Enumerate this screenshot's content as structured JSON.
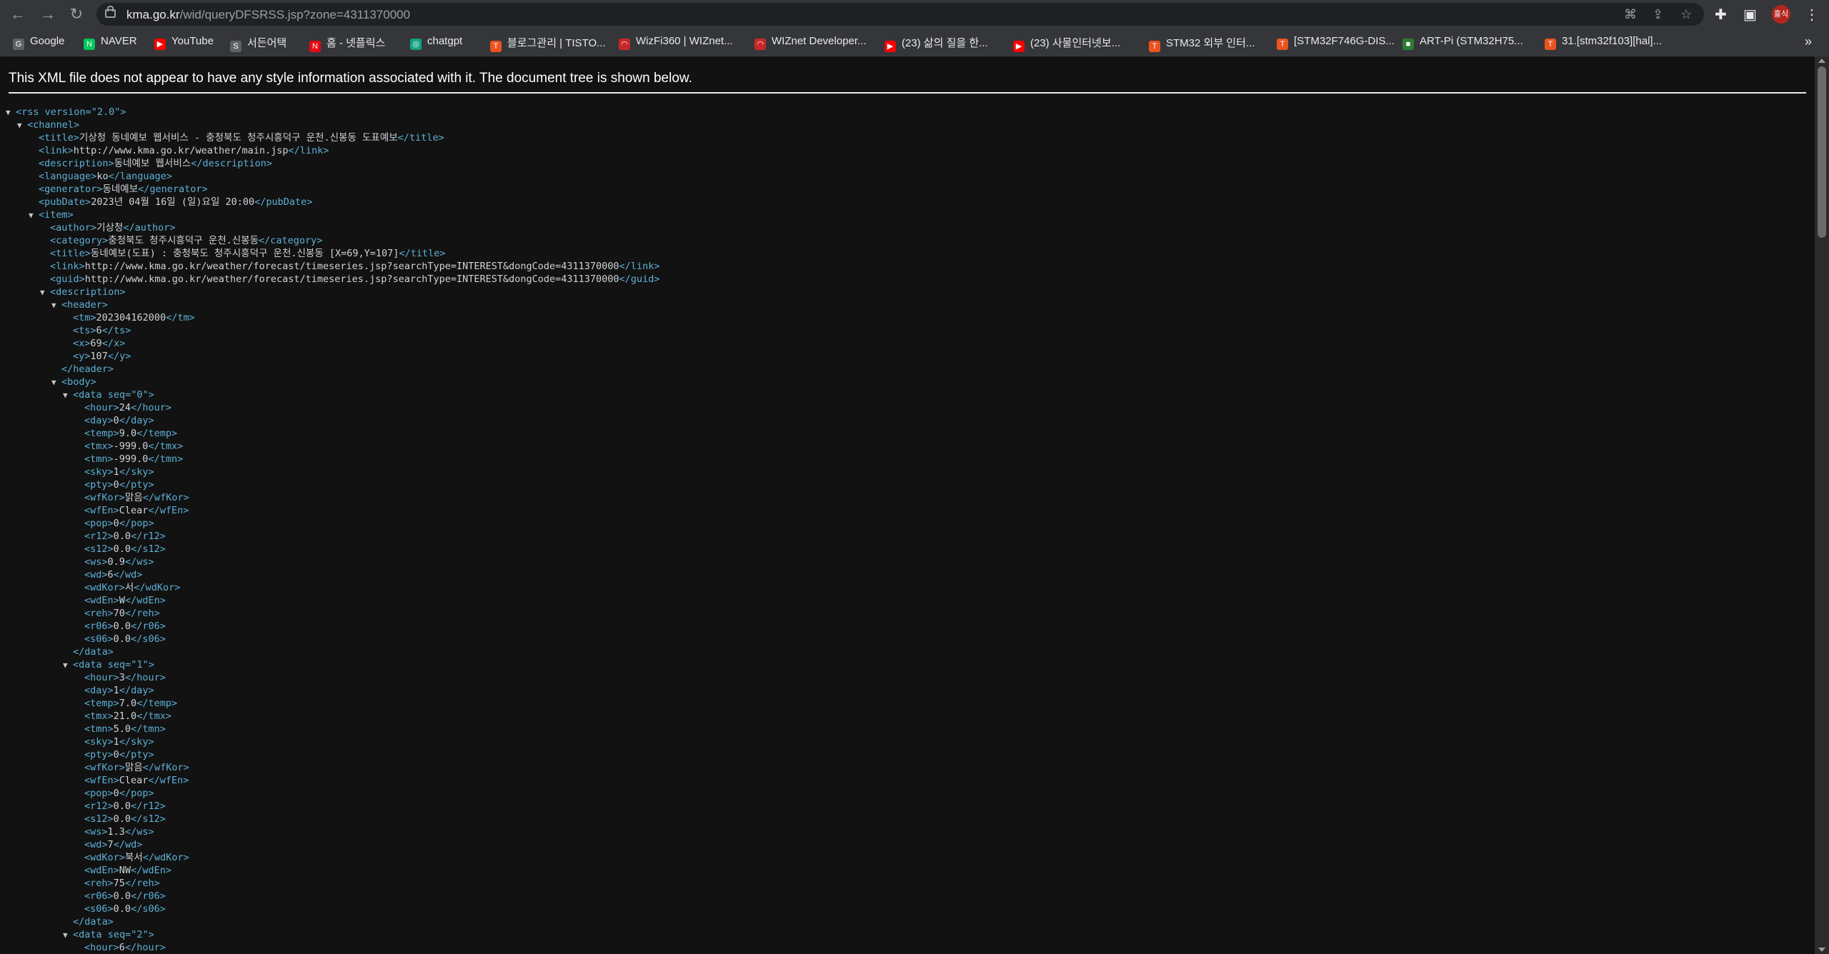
{
  "browser": {
    "url_host": "kma.go.kr",
    "url_path": "/wid/queryDFSRSS.jsp?zone=4311370000",
    "profile_initials": "홍식"
  },
  "bookmarks": [
    {
      "label": "Google",
      "color": "#5f6368",
      "glyph": "G"
    },
    {
      "label": "NAVER",
      "color": "#03c75a",
      "glyph": "N"
    },
    {
      "label": "YouTube",
      "color": "#ff0000",
      "glyph": "▶"
    },
    {
      "label": "서든어택",
      "color": "#5f6368",
      "glyph": "S"
    },
    {
      "label": "홈 - 넷플릭스",
      "color": "#e50914",
      "glyph": "N"
    },
    {
      "label": "chatgpt",
      "color": "#10a37f",
      "glyph": "◎"
    },
    {
      "label": "블로그관리 | TISTO...",
      "color": "#eb531f",
      "glyph": "T"
    },
    {
      "label": "WizFi360 | WIZnet...",
      "color": "#c62828",
      "glyph": "◠"
    },
    {
      "label": "WIZnet Developer...",
      "color": "#c62828",
      "glyph": "◠"
    },
    {
      "label": "(23) 삶의 질을 한...",
      "color": "#ff0000",
      "glyph": "▶"
    },
    {
      "label": "(23) 사물인터넷보...",
      "color": "#ff0000",
      "glyph": "▶"
    },
    {
      "label": "STM32 외부 인터...",
      "color": "#eb531f",
      "glyph": "T"
    },
    {
      "label": "[STM32F746G-DIS...",
      "color": "#eb531f",
      "glyph": "T"
    },
    {
      "label": "ART-Pi (STM32H75...",
      "color": "#2e7d32",
      "glyph": "■"
    },
    {
      "label": "31.[stm32f103][hal]...",
      "color": "#eb531f",
      "glyph": "T"
    }
  ],
  "banner": "This XML file does not appear to have any style information associated with it. The document tree is shown below.",
  "xml": [
    {
      "d": 0,
      "t": "o",
      "n": "rss",
      "a": "version=\"2.0\"",
      "c": true
    },
    {
      "d": 1,
      "t": "o",
      "n": "channel",
      "c": true
    },
    {
      "d": 2,
      "t": "e",
      "n": "title",
      "v": "기상청 동네예보 웹서비스 - 충청북도 청주시흥덕구 운천.신봉동 도표예보"
    },
    {
      "d": 2,
      "t": "e",
      "n": "link",
      "v": "http://www.kma.go.kr/weather/main.jsp"
    },
    {
      "d": 2,
      "t": "e",
      "n": "description",
      "v": "동네예보 웹서비스"
    },
    {
      "d": 2,
      "t": "e",
      "n": "language",
      "v": "ko"
    },
    {
      "d": 2,
      "t": "e",
      "n": "generator",
      "v": "동네예보"
    },
    {
      "d": 2,
      "t": "e",
      "n": "pubDate",
      "v": "2023년 04월 16일 (일)요일 20:00"
    },
    {
      "d": 2,
      "t": "o",
      "n": "item",
      "c": true
    },
    {
      "d": 3,
      "t": "e",
      "n": "author",
      "v": "기상청"
    },
    {
      "d": 3,
      "t": "e",
      "n": "category",
      "v": "충청북도 청주시흥덕구 운천.신봉동"
    },
    {
      "d": 3,
      "t": "e",
      "n": "title",
      "v": "동네예보(도표) : 충청북도 청주시흥덕구 운천.신봉동 [X=69,Y=107]"
    },
    {
      "d": 3,
      "t": "e",
      "n": "link",
      "v": "http://www.kma.go.kr/weather/forecast/timeseries.jsp?searchType=INTEREST&dongCode=4311370000"
    },
    {
      "d": 3,
      "t": "e",
      "n": "guid",
      "v": "http://www.kma.go.kr/weather/forecast/timeseries.jsp?searchType=INTEREST&dongCode=4311370000"
    },
    {
      "d": 3,
      "t": "o",
      "n": "description",
      "c": true
    },
    {
      "d": 4,
      "t": "o",
      "n": "header",
      "c": true
    },
    {
      "d": 5,
      "t": "e",
      "n": "tm",
      "v": "202304162000"
    },
    {
      "d": 5,
      "t": "e",
      "n": "ts",
      "v": "6"
    },
    {
      "d": 5,
      "t": "e",
      "n": "x",
      "v": "69"
    },
    {
      "d": 5,
      "t": "e",
      "n": "y",
      "v": "107"
    },
    {
      "d": 4,
      "t": "c",
      "n": "header"
    },
    {
      "d": 4,
      "t": "o",
      "n": "body",
      "c": true
    },
    {
      "d": 5,
      "t": "o",
      "n": "data",
      "a": "seq=\"0\"",
      "c": true
    },
    {
      "d": 6,
      "t": "e",
      "n": "hour",
      "v": "24"
    },
    {
      "d": 6,
      "t": "e",
      "n": "day",
      "v": "0"
    },
    {
      "d": 6,
      "t": "e",
      "n": "temp",
      "v": "9.0"
    },
    {
      "d": 6,
      "t": "e",
      "n": "tmx",
      "v": "-999.0"
    },
    {
      "d": 6,
      "t": "e",
      "n": "tmn",
      "v": "-999.0"
    },
    {
      "d": 6,
      "t": "e",
      "n": "sky",
      "v": "1"
    },
    {
      "d": 6,
      "t": "e",
      "n": "pty",
      "v": "0"
    },
    {
      "d": 6,
      "t": "e",
      "n": "wfKor",
      "v": "맑음"
    },
    {
      "d": 6,
      "t": "e",
      "n": "wfEn",
      "v": "Clear"
    },
    {
      "d": 6,
      "t": "e",
      "n": "pop",
      "v": "0"
    },
    {
      "d": 6,
      "t": "e",
      "n": "r12",
      "v": "0.0"
    },
    {
      "d": 6,
      "t": "e",
      "n": "s12",
      "v": "0.0"
    },
    {
      "d": 6,
      "t": "e",
      "n": "ws",
      "v": "0.9"
    },
    {
      "d": 6,
      "t": "e",
      "n": "wd",
      "v": "6"
    },
    {
      "d": 6,
      "t": "e",
      "n": "wdKor",
      "v": "서"
    },
    {
      "d": 6,
      "t": "e",
      "n": "wdEn",
      "v": "W"
    },
    {
      "d": 6,
      "t": "e",
      "n": "reh",
      "v": "70"
    },
    {
      "d": 6,
      "t": "e",
      "n": "r06",
      "v": "0.0"
    },
    {
      "d": 6,
      "t": "e",
      "n": "s06",
      "v": "0.0"
    },
    {
      "d": 5,
      "t": "c",
      "n": "data"
    },
    {
      "d": 5,
      "t": "o",
      "n": "data",
      "a": "seq=\"1\"",
      "c": true
    },
    {
      "d": 6,
      "t": "e",
      "n": "hour",
      "v": "3"
    },
    {
      "d": 6,
      "t": "e",
      "n": "day",
      "v": "1"
    },
    {
      "d": 6,
      "t": "e",
      "n": "temp",
      "v": "7.0"
    },
    {
      "d": 6,
      "t": "e",
      "n": "tmx",
      "v": "21.0"
    },
    {
      "d": 6,
      "t": "e",
      "n": "tmn",
      "v": "5.0"
    },
    {
      "d": 6,
      "t": "e",
      "n": "sky",
      "v": "1"
    },
    {
      "d": 6,
      "t": "e",
      "n": "pty",
      "v": "0"
    },
    {
      "d": 6,
      "t": "e",
      "n": "wfKor",
      "v": "맑음"
    },
    {
      "d": 6,
      "t": "e",
      "n": "wfEn",
      "v": "Clear"
    },
    {
      "d": 6,
      "t": "e",
      "n": "pop",
      "v": "0"
    },
    {
      "d": 6,
      "t": "e",
      "n": "r12",
      "v": "0.0"
    },
    {
      "d": 6,
      "t": "e",
      "n": "s12",
      "v": "0.0"
    },
    {
      "d": 6,
      "t": "e",
      "n": "ws",
      "v": "1.3"
    },
    {
      "d": 6,
      "t": "e",
      "n": "wd",
      "v": "7"
    },
    {
      "d": 6,
      "t": "e",
      "n": "wdKor",
      "v": "북서"
    },
    {
      "d": 6,
      "t": "e",
      "n": "wdEn",
      "v": "NW"
    },
    {
      "d": 6,
      "t": "e",
      "n": "reh",
      "v": "75"
    },
    {
      "d": 6,
      "t": "e",
      "n": "r06",
      "v": "0.0"
    },
    {
      "d": 6,
      "t": "e",
      "n": "s06",
      "v": "0.0"
    },
    {
      "d": 5,
      "t": "c",
      "n": "data"
    },
    {
      "d": 5,
      "t": "o",
      "n": "data",
      "a": "seq=\"2\"",
      "c": true
    },
    {
      "d": 6,
      "t": "o",
      "n": "hour",
      "v": "6",
      "tail": "</hour>"
    }
  ]
}
